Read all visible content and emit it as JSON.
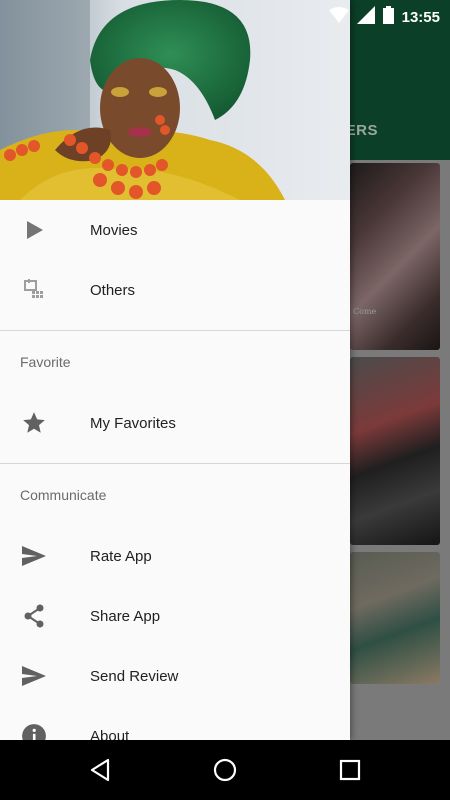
{
  "status_bar": {
    "time": "13:55"
  },
  "background": {
    "tab_fragment": "ERS",
    "card_caption": "Come"
  },
  "drawer": {
    "main_items": [
      {
        "label": "Movies",
        "icon": "play-icon"
      },
      {
        "label": "Others",
        "icon": "calendar-grid-icon"
      }
    ],
    "sections": [
      {
        "title": "Favorite",
        "items": [
          {
            "label": "My Favorites",
            "icon": "star-icon"
          }
        ]
      },
      {
        "title": "Communicate",
        "items": [
          {
            "label": "Rate App",
            "icon": "send-icon"
          },
          {
            "label": "Share App",
            "icon": "share-icon"
          },
          {
            "label": "Send Review",
            "icon": "send-icon"
          },
          {
            "label": "About",
            "icon": "info-icon"
          }
        ]
      }
    ]
  },
  "colors": {
    "app_bar": "#0b3f27",
    "drawer_bg": "#fafafa",
    "icon_gray": "#757575"
  }
}
